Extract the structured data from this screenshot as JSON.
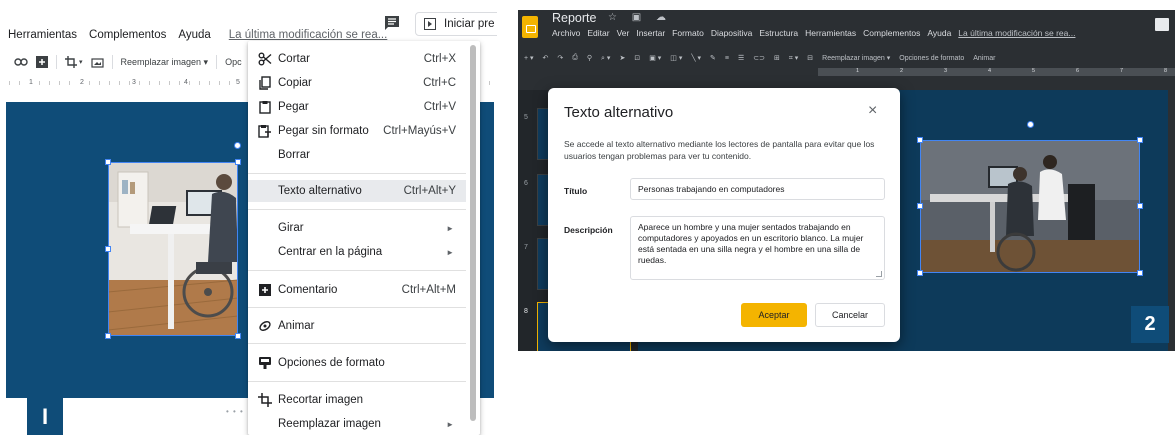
{
  "panel1": {
    "menubar": {
      "items": [
        "Herramientas",
        "Complementos",
        "Ayuda"
      ],
      "last_modified": "La última modificación se rea..."
    },
    "present_button": "Iniciar pre",
    "toolbar": {
      "replace_image": "Reemplazar imagen ▾",
      "format_options_short": "Opc"
    },
    "ruler_marks": [
      "1",
      "2",
      "3",
      "4",
      "5"
    ],
    "badge": "I",
    "context_menu": {
      "items": [
        {
          "label": "Cortar",
          "shortcut": "Ctrl+X",
          "icon": "scissors-icon"
        },
        {
          "label": "Copiar",
          "shortcut": "Ctrl+C",
          "icon": "copy-icon"
        },
        {
          "label": "Pegar",
          "shortcut": "Ctrl+V",
          "icon": "paste-icon"
        },
        {
          "label": "Pegar sin formato",
          "shortcut": "Ctrl+Mayús+V",
          "icon": "paste-plain-icon"
        },
        {
          "label": "Borrar",
          "shortcut": ""
        },
        {
          "label": "Texto alternativo",
          "shortcut": "Ctrl+Alt+Y",
          "highlighted": true
        },
        {
          "label": "Girar",
          "submenu": true
        },
        {
          "label": "Centrar en la página",
          "submenu": true
        },
        {
          "label": "Comentario",
          "shortcut": "Ctrl+Alt+M",
          "icon": "add-comment-icon"
        },
        {
          "label": "Animar",
          "icon": "animate-icon"
        },
        {
          "label": "Opciones de formato",
          "icon": "format-options-icon"
        },
        {
          "label": "Recortar imagen",
          "icon": "crop-icon"
        },
        {
          "label": "Reemplazar imagen",
          "submenu": true
        }
      ]
    }
  },
  "panel2": {
    "doc_title": "Reporte",
    "menubar": {
      "items": [
        "Archivo",
        "Editar",
        "Ver",
        "Insertar",
        "Formato",
        "Diapositiva",
        "Estructura",
        "Herramientas",
        "Complementos",
        "Ayuda"
      ],
      "last_modified": "La última modificación se rea..."
    },
    "toolbar": {
      "replace_image": "Reemplazar imagen ▾",
      "format_options": "Opciones de formato",
      "animate": "Animar"
    },
    "ruler_marks": [
      "1",
      "2",
      "3",
      "4",
      "5",
      "6",
      "7",
      "8"
    ],
    "slide_numbers": [
      "5",
      "6",
      "7",
      "8"
    ],
    "badge": "2",
    "dialog": {
      "title": "Texto alternativo",
      "description": "Se accede al texto alternativo mediante los lectores de pantalla para evitar que los usuarios tengan problemas para ver tu contenido.",
      "title_label": "Título",
      "title_value": "Personas trabajando en computadores",
      "description_label": "Descripción",
      "description_value": "Aparece un hombre y una mujer sentados trabajando en computadores y apoyados en un escritorio blanco. La mujer está sentada en una silla negra y el hombre en una silla de ruedas.",
      "accept": "Aceptar",
      "cancel": "Cancelar"
    }
  },
  "colors": {
    "slide_bg": "#0f4c78",
    "selection": "#4285f4",
    "accept_button": "#f4b400",
    "dark_ui": "#2b2f33"
  }
}
